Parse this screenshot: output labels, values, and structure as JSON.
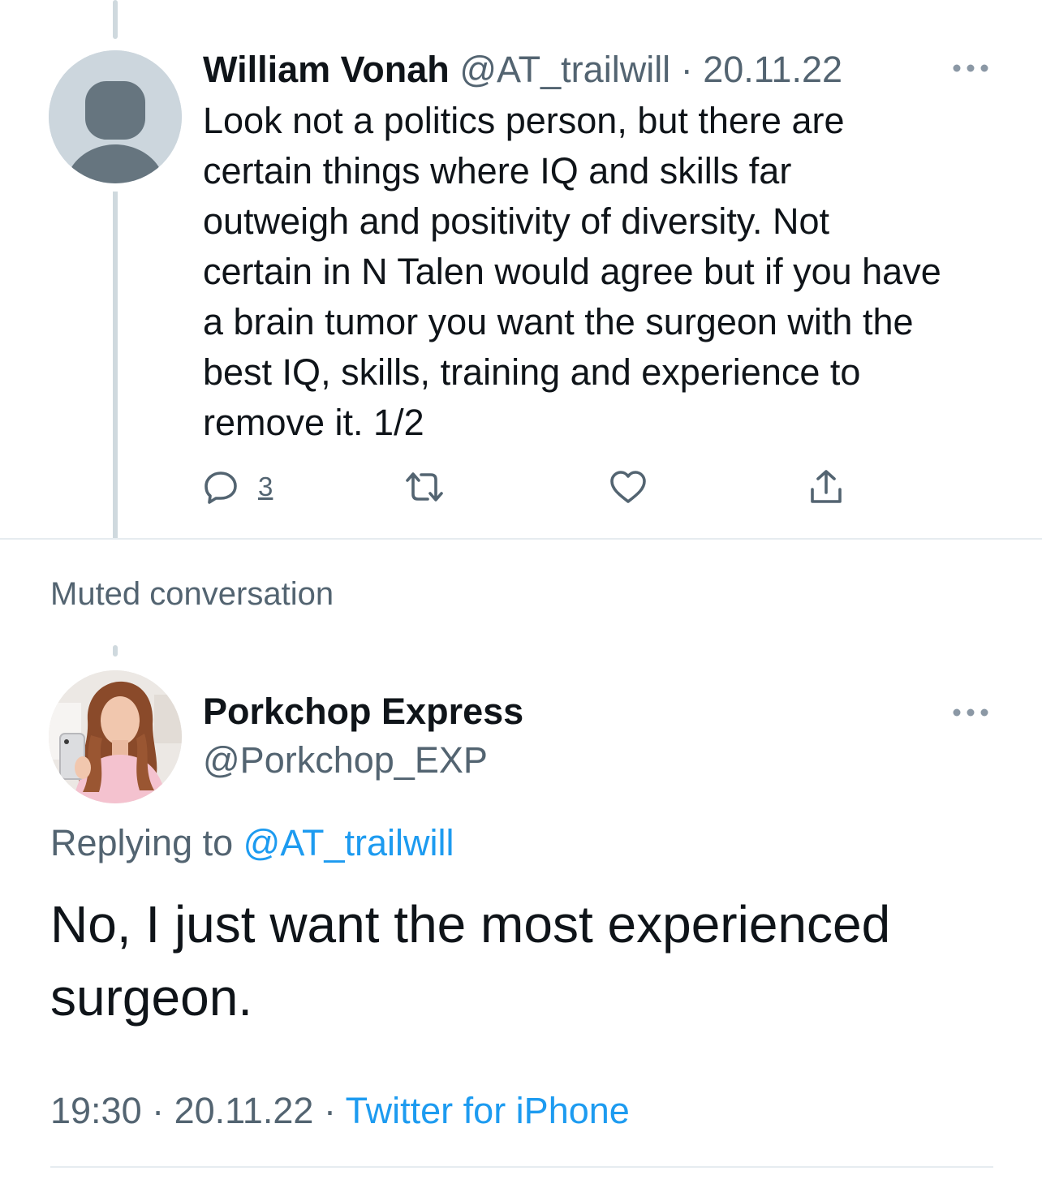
{
  "tweet1": {
    "name": "William Vonah",
    "handle": "@AT_trailwill",
    "separator": " · ",
    "date": "20.11.22",
    "body_lines": [
      "Look not a politics person, but there are",
      "certain things where IQ and skills far",
      "outweigh and positivity of diversity. Not",
      "certain in N Talen would agree but if you have",
      "a brain tumor you want the surgeon with the",
      "best IQ, skills, training and experience to",
      "remove it. 1/2"
    ],
    "reply_count": "3",
    "icons": {
      "more": "more-horizontal-icon",
      "reply": "reply-icon",
      "retweet": "retweet-icon",
      "like": "heart-icon",
      "share": "share-icon",
      "avatar": "default-avatar-icon"
    }
  },
  "muted_label": "Muted conversation",
  "tweet2": {
    "name": "Porkchop Express",
    "handle": "@Porkchop_EXP",
    "replying_prefix": "Replying to ",
    "replying_handle": "@AT_trailwill",
    "body_lines": [
      "No, I just want the most experienced",
      "surgeon."
    ],
    "time": "19:30",
    "separator1": " · ",
    "date": "20.11.22",
    "separator2": " · ",
    "source": "Twitter for iPhone",
    "icons": {
      "more": "more-horizontal-icon",
      "avatar": "profile-photo"
    }
  },
  "colors": {
    "text": "#0f1419",
    "secondary": "#536471",
    "link": "#1d9bf0",
    "thread_line": "#cfd9de",
    "divider": "#e6ecf0",
    "default_avatar_bg": "#ccd6dd",
    "default_avatar_fg": "#66757f"
  }
}
